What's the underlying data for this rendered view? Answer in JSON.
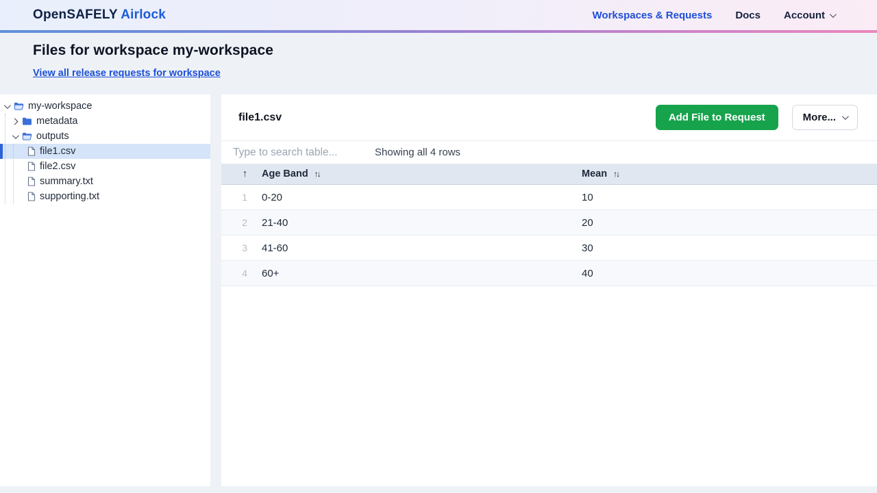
{
  "navbar": {
    "brand": {
      "primary": "OpenSAFELY",
      "secondary": "Airlock"
    },
    "links": [
      {
        "label": "Workspaces & Requests"
      },
      {
        "label": "Docs"
      }
    ],
    "account": {
      "label": "Account",
      "icon": "chevron-down-icon"
    }
  },
  "header": {
    "title": "Files for workspace my-workspace",
    "link": "View all release requests for workspace"
  },
  "file_tree": {
    "items": [
      {
        "label": "my-workspace",
        "level": 0,
        "icon": "folder-open",
        "expanded": true,
        "selected": false
      },
      {
        "label": "metadata",
        "level": 1,
        "icon": "folder-closed",
        "expanded": false,
        "selected": false
      },
      {
        "label": "outputs",
        "level": 1,
        "icon": "folder-open",
        "expanded": true,
        "selected": false
      },
      {
        "label": "file1.csv",
        "level": 2,
        "icon": "file",
        "selected": true
      },
      {
        "label": "file2.csv",
        "level": 2,
        "icon": "file",
        "selected": false
      },
      {
        "label": "summary.txt",
        "level": 2,
        "icon": "file",
        "selected": false
      },
      {
        "label": "supporting.txt",
        "level": 2,
        "icon": "file",
        "selected": false
      }
    ]
  },
  "content": {
    "file_title": "file1.csv",
    "add_file_button": "Add File to Request",
    "more_button": "More...",
    "search_placeholder": "Type to search table...",
    "rows_status": "Showing all 4 rows",
    "table": {
      "sort_ascending_icon": "↑",
      "sort_both_icon": "↑↓",
      "columns": [
        "Age Band",
        "Mean"
      ],
      "rows": [
        {
          "index": "1",
          "age_band": "0-20",
          "mean": "10"
        },
        {
          "index": "2",
          "age_band": "21-40",
          "mean": "20"
        },
        {
          "index": "3",
          "age_band": "41-60",
          "mean": "30"
        },
        {
          "index": "4",
          "age_band": "60+",
          "mean": "40"
        }
      ]
    }
  },
  "colors": {
    "brand_navy": "#0e2146",
    "accent_blue": "#1d4ed8",
    "button_green": "#17a34c",
    "selected_tree_bg": "#d5e4f8",
    "table_header_bg": "#e1e7f0",
    "gradient_border": [
      "#5e90da",
      "#a27fd0",
      "#ea87bc"
    ]
  }
}
